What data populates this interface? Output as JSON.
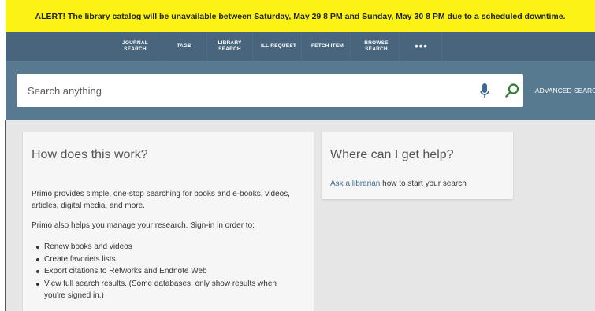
{
  "alert": {
    "text": "ALERT! The library catalog will be unavailable between Saturday, May 29 8 PM and Sunday, May 30 8 PM due to a scheduled downtime."
  },
  "nav": {
    "items": [
      {
        "line1": "JOURNAL",
        "line2": "SEARCH"
      },
      {
        "line1": "TAGS",
        "line2": ""
      },
      {
        "line1": "LIBRARY",
        "line2": "SEARCH"
      },
      {
        "line1": "ILL REQUEST",
        "line2": ""
      },
      {
        "line1": "FETCH ITEM",
        "line2": ""
      },
      {
        "line1": "BROWSE",
        "line2": "SEARCH"
      }
    ],
    "more": "•••"
  },
  "search": {
    "placeholder": "Search anything",
    "value": "",
    "advanced_label": "ADVANCED SEARC",
    "mic_icon": "microphone-icon",
    "search_icon": "magnifier-icon"
  },
  "how": {
    "title": "How does this work?",
    "para1": "Primo provides simple, one-stop searching for books and e-books, videos, articles, digital media, and more.",
    "para2": "Primo also helps you manage your research. Sign-in in order to:",
    "bullets": [
      "Renew books and videos",
      "Create favoriets lists",
      "Export citations to Refworks and Endnote Web",
      "View full search results. (Some databases, only show results when you're signed in.)"
    ]
  },
  "help": {
    "title": "Where can I get help?",
    "link_text": "Ask a librarian",
    "rest_text": " how to start your search"
  },
  "colors": {
    "alert_bg": "#fbf313",
    "nav_bg": "#48657d",
    "search_band_bg": "#577a91",
    "accent_green": "#2e7d2e",
    "link": "#3c6c91"
  }
}
